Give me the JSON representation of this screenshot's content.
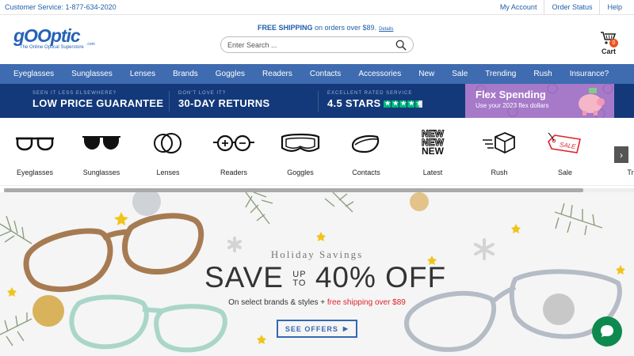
{
  "topbar": {
    "customer_service_label": "Customer Service:",
    "phone": "1-877-634-2020",
    "links": [
      "My Account",
      "Order Status",
      "Help"
    ]
  },
  "header": {
    "logo_text": "gOOptic",
    "logo_dotcom": ".com",
    "logo_tagline": "The Online Optical Superstore",
    "shipping_bold": "FREE SHIPPING",
    "shipping_rest": " on orders over $89.",
    "shipping_details": "Details",
    "search_placeholder": "Enter Search ...",
    "cart_label": "Cart",
    "cart_count": "0"
  },
  "nav": {
    "items": [
      "Eyeglasses",
      "Sunglasses",
      "Lenses",
      "Brands",
      "Goggles",
      "Readers",
      "Contacts",
      "Accessories",
      "New",
      "Sale",
      "Trending",
      "Rush",
      "Insurance?"
    ]
  },
  "promo": {
    "guarantee_small": "SEEN IT LESS ELSEWHERE?",
    "guarantee_big": "LOW PRICE GUARANTEE",
    "returns_small": "DON'T LOVE IT?",
    "returns_big": "30-DAY RETURNS",
    "rating_small": "EXCELLENT RATED SERVICE",
    "rating_big": "4.5 STARS",
    "rating_value": 4.5,
    "flex_title": "Flex Spending",
    "flex_sub": "Use your 2023 flex dollars"
  },
  "categories": {
    "items": [
      {
        "label": "Eyeglasses",
        "icon": "eyeglasses-icon"
      },
      {
        "label": "Sunglasses",
        "icon": "sunglasses-icon"
      },
      {
        "label": "Lenses",
        "icon": "lenses-icon"
      },
      {
        "label": "Readers",
        "icon": "readers-icon"
      },
      {
        "label": "Goggles",
        "icon": "goggles-icon"
      },
      {
        "label": "Contacts",
        "icon": "contacts-icon"
      },
      {
        "label": "Latest",
        "icon": "new-badge-icon"
      },
      {
        "label": "Rush",
        "icon": "rush-box-icon"
      },
      {
        "label": "Sale",
        "icon": "sale-tag-icon"
      },
      {
        "label": "Tre",
        "icon": "trending-icon"
      }
    ],
    "new_text": "NEW"
  },
  "hero": {
    "subtitle": "Holiday Savings",
    "save_word": "SAVE",
    "up_word": "UP",
    "to_word": "TO",
    "percent_text": "40% OFF",
    "on_select": "On select brands & styles + ",
    "free_shipping": "free shipping over $89",
    "offers_button": "SEE OFFERS"
  },
  "colors": {
    "nav_bg": "#3f6bb0",
    "promo_bg": "#13397a",
    "brand_blue": "#2561b7",
    "trustpilot_green": "#00b67a",
    "flex_purple": "#a679c9",
    "chat_green": "#0e8a4f",
    "sale_red": "#e0232b"
  }
}
